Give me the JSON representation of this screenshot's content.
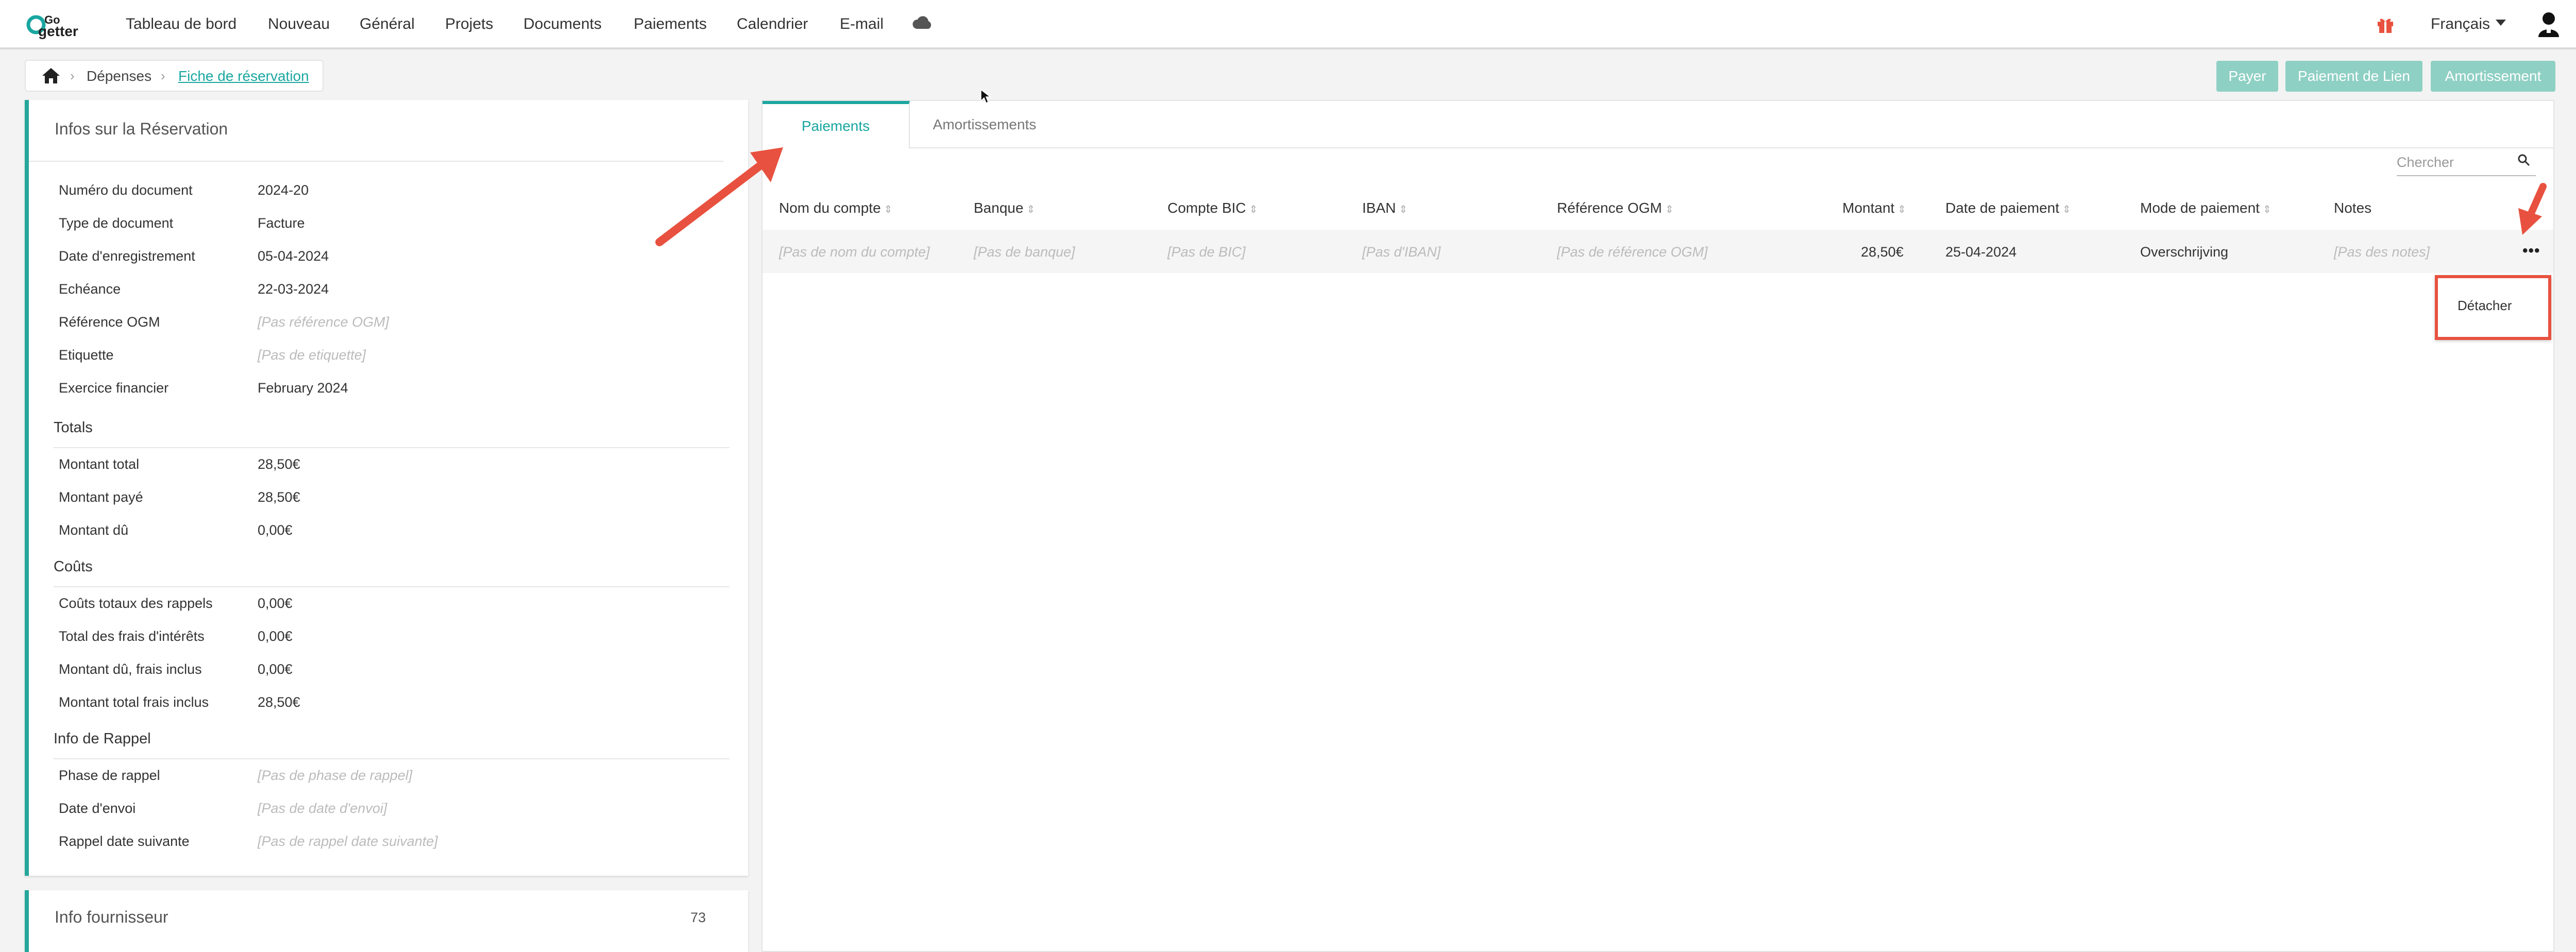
{
  "nav": {
    "items": [
      "Tableau de bord",
      "Nouveau",
      "Général",
      "Projets",
      "Documents",
      "Paiements",
      "Calendrier",
      "E-mail"
    ],
    "language": "Français"
  },
  "breadcrumb": {
    "items": [
      "Dépenses",
      "Fiche de réservation"
    ]
  },
  "actions": {
    "pay": "Payer",
    "link_payment": "Paiement de Lien",
    "amortization": "Amortissement"
  },
  "reservation": {
    "title": "Infos sur la Réservation",
    "fields": [
      {
        "label": "Numéro du document",
        "value": "2024-20",
        "empty": false
      },
      {
        "label": "Type de document",
        "value": "Facture",
        "empty": false
      },
      {
        "label": "Date d'enregistrement",
        "value": "05-04-2024",
        "empty": false
      },
      {
        "label": "Echéance",
        "value": "22-03-2024",
        "empty": false
      },
      {
        "label": "Référence OGM",
        "value": "[Pas référence OGM]",
        "empty": true
      },
      {
        "label": "Etiquette",
        "value": "[Pas de etiquette]",
        "empty": true
      },
      {
        "label": "Exercice financier",
        "value": "February 2024",
        "empty": false
      }
    ],
    "totals_title": "Totals",
    "totals": [
      {
        "label": "Montant total",
        "value": "28,50€"
      },
      {
        "label": "Montant payé",
        "value": "28,50€"
      },
      {
        "label": "Montant dû",
        "value": "0,00€"
      }
    ],
    "costs_title": "Coûts",
    "costs": [
      {
        "label": "Coûts totaux des rappels",
        "value": "0,00€"
      },
      {
        "label": "Total des frais d'intérêts",
        "value": "0,00€"
      },
      {
        "label": "Montant dû, frais inclus",
        "value": "0,00€"
      },
      {
        "label": "Montant total frais inclus",
        "value": "28,50€"
      }
    ],
    "reminder_title": "Info de Rappel",
    "reminder": [
      {
        "label": "Phase de rappel",
        "value": "[Pas de phase de rappel]"
      },
      {
        "label": "Date d'envoi",
        "value": "[Pas de date d'envoi]"
      },
      {
        "label": "Rappel date suivante",
        "value": "[Pas de rappel date suivante]"
      }
    ]
  },
  "supplier": {
    "title": "Info fournisseur",
    "count": "73"
  },
  "tabs": [
    "Paiements",
    "Amortissements"
  ],
  "search": {
    "placeholder": "Chercher"
  },
  "table": {
    "headers": [
      "Nom du compte",
      "Banque",
      "Compte BIC",
      "IBAN",
      "Référence OGM",
      "Montant",
      "Date de paiement",
      "Mode de paiement",
      "Notes"
    ],
    "row": [
      "[Pas de nom du compte]",
      "[Pas de banque]",
      "[Pas de BIC]",
      "[Pas d'IBAN]",
      "[Pas de référence OGM]",
      "28,50€",
      "25-04-2024",
      "Overschrijving",
      "[Pas des notes]"
    ]
  },
  "dropdown": {
    "detach": "Détacher"
  },
  "colors": {
    "accent": "#1aa6a0",
    "button_disabled": "#8fd0c4",
    "annotation": "#e8513f"
  }
}
